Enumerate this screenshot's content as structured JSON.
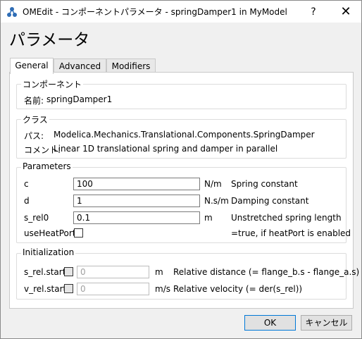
{
  "window": {
    "title": "OMEdit - コンポーネントパラメータ - springDamper1 in MyModel",
    "help": "?",
    "close": "✕"
  },
  "heading": "パラメータ",
  "tabs": [
    {
      "label": "General",
      "active": true
    },
    {
      "label": "Advanced",
      "active": false
    },
    {
      "label": "Modifiers",
      "active": false
    }
  ],
  "component": {
    "title": "コンポーネント",
    "name_label": "名前:",
    "name_value": "springDamper1"
  },
  "class": {
    "title": "クラス",
    "path_label": "パス:",
    "path_value": "Modelica.Mechanics.Translational.Components.SpringDamper",
    "comment_label": "コメント:",
    "comment_value": "Linear 1D translational spring and damper in parallel"
  },
  "parameters": {
    "title": "Parameters",
    "rows": [
      {
        "name": "c",
        "value": "100",
        "unit": "N/m",
        "desc": "Spring constant"
      },
      {
        "name": "d",
        "value": "1",
        "unit": "N.s/m",
        "desc": "Damping constant"
      },
      {
        "name": "s_rel0",
        "value": "0.1",
        "unit": "m",
        "desc": "Unstretched spring length"
      }
    ],
    "heatport": {
      "name": "useHeatPort",
      "desc": "=true, if heatPort is enabled",
      "checked": false
    }
  },
  "initialization": {
    "title": "Initialization",
    "rows": [
      {
        "name": "s_rel.start",
        "value": "0",
        "unit": "m",
        "desc": "Relative distance (= flange_b.s - flange_a.s)",
        "checked": false
      },
      {
        "name": "v_rel.start",
        "value": "0",
        "unit": "m/s",
        "desc": "Relative velocity (= der(s_rel))",
        "checked": false
      }
    ]
  },
  "buttons": {
    "ok": "OK",
    "cancel": "キャンセル"
  }
}
